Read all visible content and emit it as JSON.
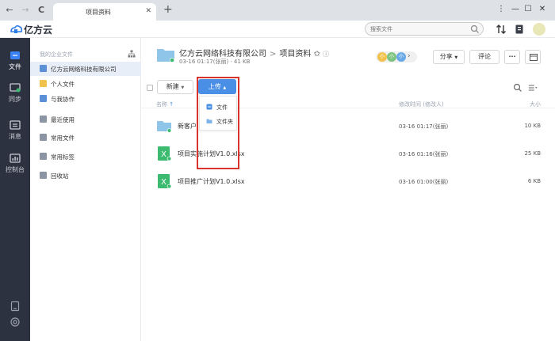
{
  "browser": {
    "tab_title": "项目资料",
    "close_glyph": "✕",
    "new_tab_glyph": "+",
    "back_glyph": "←",
    "forward_glyph": "→",
    "reload_glyph": "C",
    "menu_glyph": "⋮",
    "minimize_glyph": "—",
    "maximize_glyph": "☐",
    "close_window_glyph": "✕"
  },
  "header": {
    "brand": "亿方云",
    "search_placeholder": "搜索文件",
    "icons": [
      "transfer-icon",
      "notification-icon",
      "user-avatar"
    ]
  },
  "rail": {
    "items": [
      {
        "label": "文件",
        "icon": "file-icon"
      },
      {
        "label": "同步",
        "icon": "sync-icon"
      },
      {
        "label": "消息",
        "icon": "message-icon"
      },
      {
        "label": "控制台",
        "icon": "console-icon"
      }
    ],
    "bottom_icons": [
      "client-icon",
      "help-icon"
    ]
  },
  "sidebar": {
    "section_label": "我的企业文件",
    "items": [
      {
        "label": "亿方云网络科技有限公司",
        "color": "#5b8fd6",
        "active": true
      },
      {
        "label": "个人文件",
        "color": "#f1c24b",
        "active": false
      },
      {
        "label": "与我协作",
        "color": "#5b8fd6",
        "active": false
      },
      {
        "label": "最近使用",
        "color": "#8c95a3",
        "active": false
      },
      {
        "label": "常用文件",
        "color": "#8c95a3",
        "active": false
      },
      {
        "label": "常用标签",
        "color": "#8c95a3",
        "active": false
      },
      {
        "label": "回收站",
        "color": "#8c95a3",
        "active": false
      }
    ]
  },
  "folder": {
    "company": "亿方云网络科技有限公司",
    "separator": ">",
    "name": "项目资料",
    "star_glyph": "✩",
    "info_glyph": "ⓘ",
    "meta": "03-16 01:17(张丽)  · 41 KB",
    "collaborators": [
      {
        "initial": "小",
        "color": "#f1c24b"
      },
      {
        "initial": "小",
        "color": "#7cc47f"
      },
      {
        "initial": "小",
        "color": "#6aa9e8"
      }
    ],
    "share_label": "分享",
    "comment_label": "评论",
    "more_glyph": "···"
  },
  "toolbar": {
    "new_label": "新建",
    "upload_label": "上传",
    "upload_arrow": "▲",
    "dropdown_arrow": "▼",
    "upload_menu": [
      {
        "label": "文件",
        "icon": "file-upload-icon"
      },
      {
        "label": "文件夹",
        "icon": "folder-upload-icon"
      }
    ]
  },
  "columns": {
    "name": "名称",
    "sort_glyph": "↑",
    "modified": "修改时间 (修改人)",
    "size": "大小"
  },
  "files": [
    {
      "name": "新客户",
      "type": "folder",
      "modified": "03-16 01:17(张丽)",
      "size": "10 KB"
    },
    {
      "name": "项目实施计划V1.0.xlsx",
      "type": "excel",
      "modified": "03-16 01:16(张丽)",
      "size": "25 KB"
    },
    {
      "name": "项目推广计划V1.0.xlsx",
      "type": "excel",
      "modified": "03-16 01:00(张丽)",
      "size": "6 KB"
    }
  ],
  "colors": {
    "accent": "#4a8fe6",
    "rail_bg": "#2d3240",
    "highlight": "#d9342b",
    "excel": "#3cba6f",
    "folder": "#8ec5e8"
  }
}
